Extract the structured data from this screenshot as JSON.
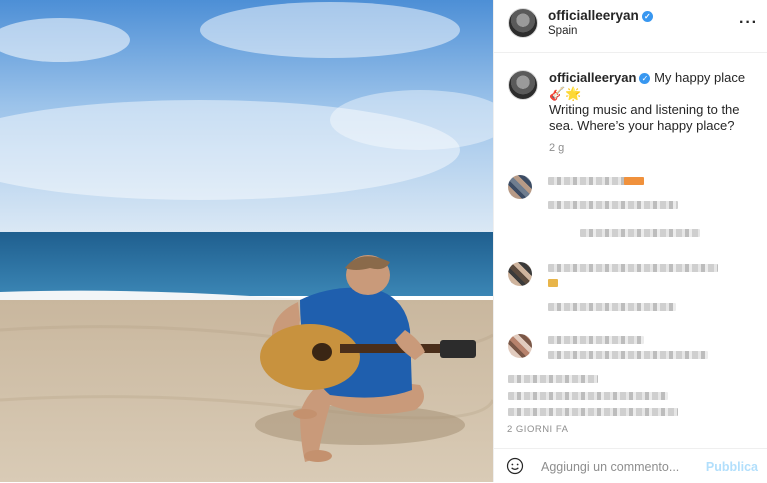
{
  "header": {
    "username": "officialleeryan",
    "location": "Spain",
    "more_icon": "ellipsis-icon"
  },
  "caption": {
    "username": "officialleeryan",
    "title": "My happy place",
    "emoji": "🎸🌟",
    "text": "Writing music and listening to the sea. Where’s your happy place?",
    "time_ago": "2 g"
  },
  "post_time": "2 GIORNI FA",
  "comment_box": {
    "placeholder": "Aggiungi un commento...",
    "publish_label": "Pubblica",
    "emoji_icon": "smiley-icon"
  },
  "colors": {
    "verified": "#3897f0",
    "publish_disabled": "#b2dffc",
    "shirt": "#1f5fae"
  }
}
